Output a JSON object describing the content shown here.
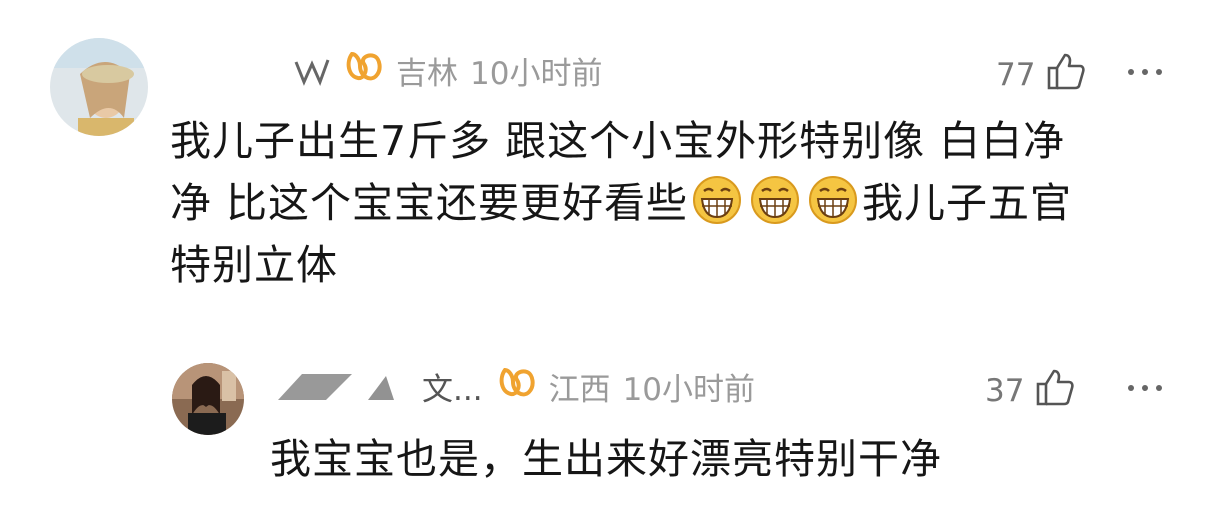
{
  "comments": [
    {
      "name": "...",
      "location": "吉林",
      "time": "10小时前",
      "likes": "77",
      "text_lines": [
        "我儿子出生7斤多 跟这个小宝外形特别像 白白净",
        "净 比这个宝宝还要更好看些",
        "我儿子五官",
        "特别立体"
      ],
      "emoji": [
        "grinning-emoji",
        "grinning-emoji",
        "grinning-emoji"
      ]
    },
    {
      "name": "文...",
      "location": "江西",
      "time": "10小时前",
      "likes": "37",
      "text_lines": [
        "我宝宝也是，生出来好漂亮特别干净"
      ]
    }
  ],
  "colors": {
    "vip_badge": "#f0a330",
    "meta_text": "#9a9a9a",
    "body_text": "#161616"
  }
}
